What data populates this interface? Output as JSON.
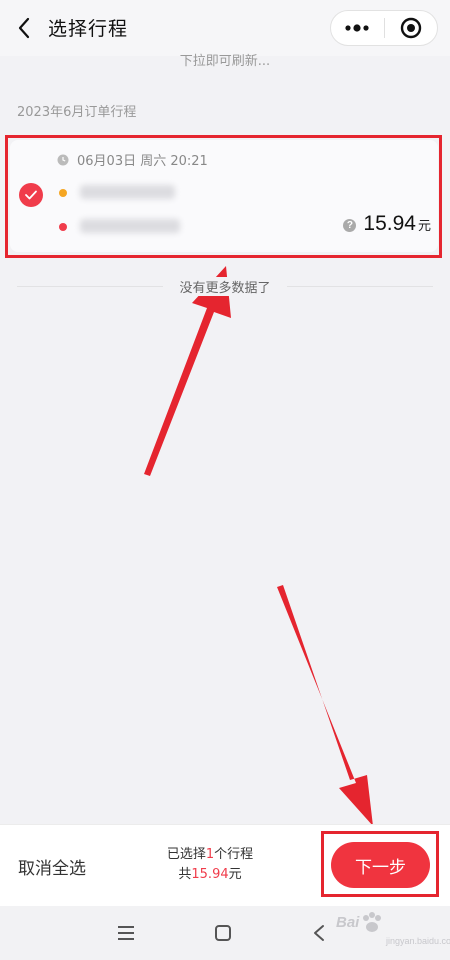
{
  "header": {
    "title": "选择行程",
    "back_icon": "chevron-left-icon",
    "menu_icon": "more-dots-icon",
    "close_icon": "target-circle-icon"
  },
  "list": {
    "pull_hint": "下拉即可刷新...",
    "section_title": "2023年6月订单行程",
    "trips": [
      {
        "time": "06月03日 周六 20:21",
        "price": "15.94",
        "unit": "元",
        "selected": true
      }
    ],
    "no_more": "没有更多数据了"
  },
  "bottom": {
    "cancel_all": "取消全选",
    "summary_prefix": "已选择",
    "summary_count": "1",
    "summary_suffix": "个行程",
    "total_prefix": "共",
    "total_value": "15.94",
    "total_unit": "元",
    "next_label": "下一步"
  },
  "watermark": {
    "brand": "Bai",
    "sub": "jingyan.baidu.com"
  },
  "colors": {
    "accent": "#f03c4b",
    "annotation": "#e5252f",
    "start_dot": "#f5a623"
  }
}
